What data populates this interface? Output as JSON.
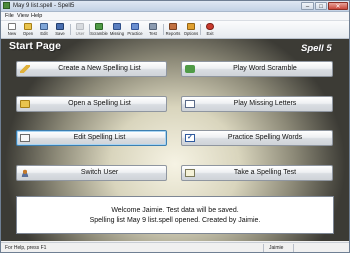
{
  "window": {
    "title": "May 9 list.spell - Spell5",
    "minimize": "–",
    "maximize": "□",
    "close": "✕"
  },
  "menu": [
    "File",
    "View",
    "Help"
  ],
  "toolbar": [
    {
      "label": "New",
      "icon": "new-icon",
      "color": "#ffffff"
    },
    {
      "label": "Open",
      "icon": "open-icon",
      "color": "#e9c44e"
    },
    {
      "label": "Edit",
      "icon": "edit-icon",
      "color": "#7fa6d8"
    },
    {
      "label": "Save",
      "icon": "save-icon",
      "color": "#4a6fb0"
    },
    {
      "label": "User",
      "icon": "user-icon",
      "color": "#c0c4c9"
    },
    {
      "label": "Scramble",
      "icon": "scramble-icon",
      "color": "#4f9b46"
    },
    {
      "label": "Missing",
      "icon": "missing-icon",
      "color": "#5a7fc0"
    },
    {
      "label": "Practice",
      "icon": "practice-icon",
      "color": "#6a8fd0"
    },
    {
      "label": "Test",
      "icon": "test-icon",
      "color": "#8a9ab0"
    },
    {
      "label": "Reports",
      "icon": "reports-icon",
      "color": "#c07040"
    },
    {
      "label": "Options",
      "icon": "options-icon",
      "color": "#e0a030"
    },
    {
      "label": "Exit",
      "icon": "exit-icon",
      "color": "#c83a2e"
    }
  ],
  "main": {
    "title": "Start Page",
    "brand": "Spell 5",
    "buttons_left": [
      {
        "label": "Create a New Spelling List",
        "icon": "pencil-icon"
      },
      {
        "label": "Open a Spelling List",
        "icon": "folder-icon"
      },
      {
        "label": "Edit Spelling List",
        "icon": "edit-list-icon"
      },
      {
        "label": "Switch User",
        "icon": "user-icon"
      }
    ],
    "buttons_right": [
      {
        "label": "Play Word Scramble",
        "icon": "puzzle-icon"
      },
      {
        "label": "Play Missing Letters",
        "icon": "missing-letters-icon"
      },
      {
        "label": "Practice Spelling Words",
        "icon": "checkbox-icon"
      },
      {
        "label": "Take a Spelling Test",
        "icon": "test-paper-icon"
      }
    ],
    "status_lines": [
      "Welcome Jaimie.  Test data will be saved.",
      "Spelling list May 9 list.spell opened.  Created by Jaimie."
    ]
  },
  "statusbar": {
    "help": "For Help, press F1",
    "user": "Jaimie"
  }
}
